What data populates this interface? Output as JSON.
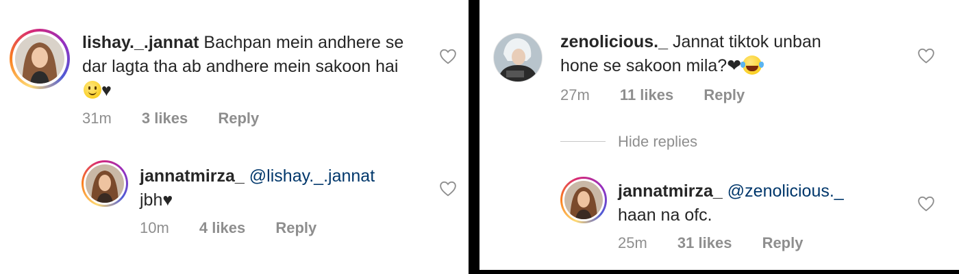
{
  "left": {
    "comment": {
      "username": "lishay._.jannat",
      "text": "Bachpan mein andhere se dar lagta tha ab andhere mein sakoon hai",
      "emoji": "slightly-smiling-face",
      "suffix": "♥",
      "time": "31m",
      "likes": "3 likes",
      "reply": "Reply",
      "like_icon": "heart-outline-icon"
    },
    "reply": {
      "username": "jannatmirza_",
      "mention": "@lishay._.jannat",
      "text": "jbh",
      "suffix": "♥",
      "time": "10m",
      "likes": "4 likes",
      "reply": "Reply",
      "like_icon": "heart-outline-icon"
    }
  },
  "right": {
    "comment": {
      "username": "zenolicious._",
      "text": "Jannat tiktok unban hone se sakoon mila?",
      "suffix": "❤",
      "emoji": "face-with-tears-of-joy",
      "time": "27m",
      "likes": "11 likes",
      "reply": "Reply",
      "like_icon": "heart-outline-icon"
    },
    "hide_replies": "Hide replies",
    "reply": {
      "username": "jannatmirza_",
      "mention": "@zenolicious._",
      "text": "haan na ofc.",
      "time": "25m",
      "likes": "31 likes",
      "reply": "Reply",
      "like_icon": "heart-outline-icon"
    }
  },
  "colors": {
    "text": "#262626",
    "secondary": "#8e8e8e",
    "mention": "#00376b",
    "divider": "#000000"
  }
}
